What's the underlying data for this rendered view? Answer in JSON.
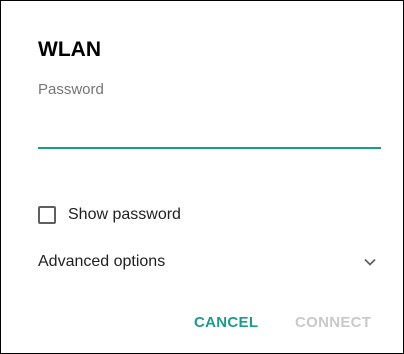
{
  "dialog": {
    "title": "WLAN",
    "password_label": "Password",
    "password_value": "",
    "show_password_label": "Show password",
    "show_password_checked": false,
    "advanced_options_label": "Advanced options",
    "cancel_label": "CANCEL",
    "connect_label": "CONNECT"
  },
  "colors": {
    "accent": "#1a9c8c",
    "disabled": "#c9c9c9",
    "secondary_text": "#757575",
    "primary_text": "#212121"
  },
  "icons": {
    "checkbox": "checkbox-unchecked-icon",
    "advanced_toggle": "chevron-down-icon"
  }
}
